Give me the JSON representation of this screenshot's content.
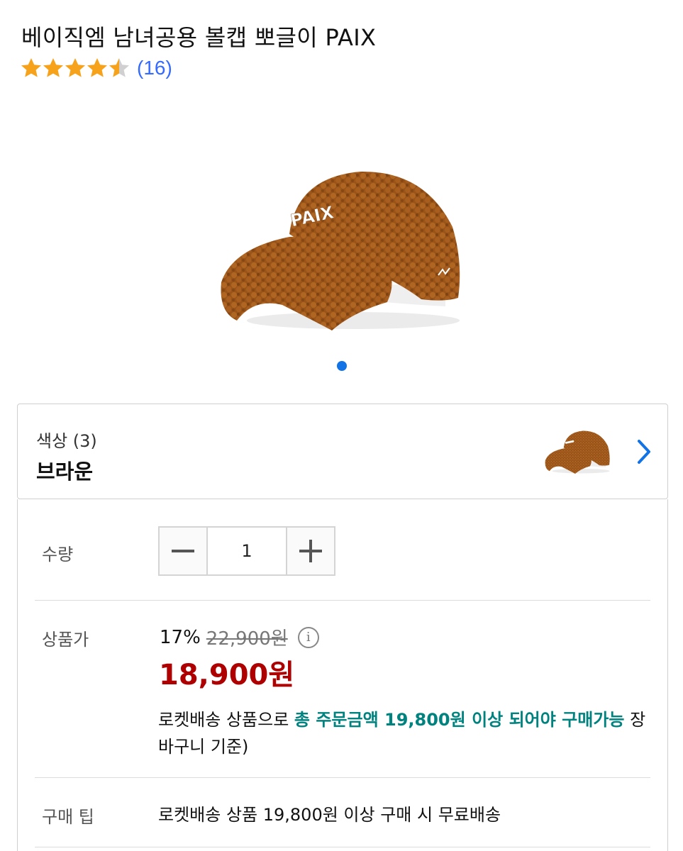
{
  "product": {
    "title": "베이직엠 남녀공용 볼캡 뽀글이 PAIX",
    "rating": 4.5,
    "review_count": "(16)",
    "image_logo_text": "PAIX"
  },
  "colors": {
    "star": "#f7a21b",
    "review_link": "#346aff",
    "dot_active": "#1173e6",
    "sale_price": "#ae0000",
    "highlight": "#00827f",
    "chevron": "#1173e6"
  },
  "option": {
    "label": "색상 (3)",
    "value": "브라운"
  },
  "quantity": {
    "label": "수량",
    "value": "1",
    "minus_icon": "minus-icon",
    "plus_icon": "plus-icon"
  },
  "price": {
    "label": "상품가",
    "discount_rate": "17%",
    "original_price": "22,900원",
    "info_icon": "i",
    "sale_price": "18,900원"
  },
  "notice": {
    "prefix": "로켓배송 상품으로 ",
    "highlight": "총 주문금액 19,800원 이상 되어야 구매가능",
    "suffix": " 장바구니 기준)"
  },
  "tip": {
    "label": "구매 팁",
    "text": "로켓배송 상품 19,800원 이상 구매 시 무료배송"
  },
  "carousel": {
    "current": 1,
    "total": 1
  }
}
